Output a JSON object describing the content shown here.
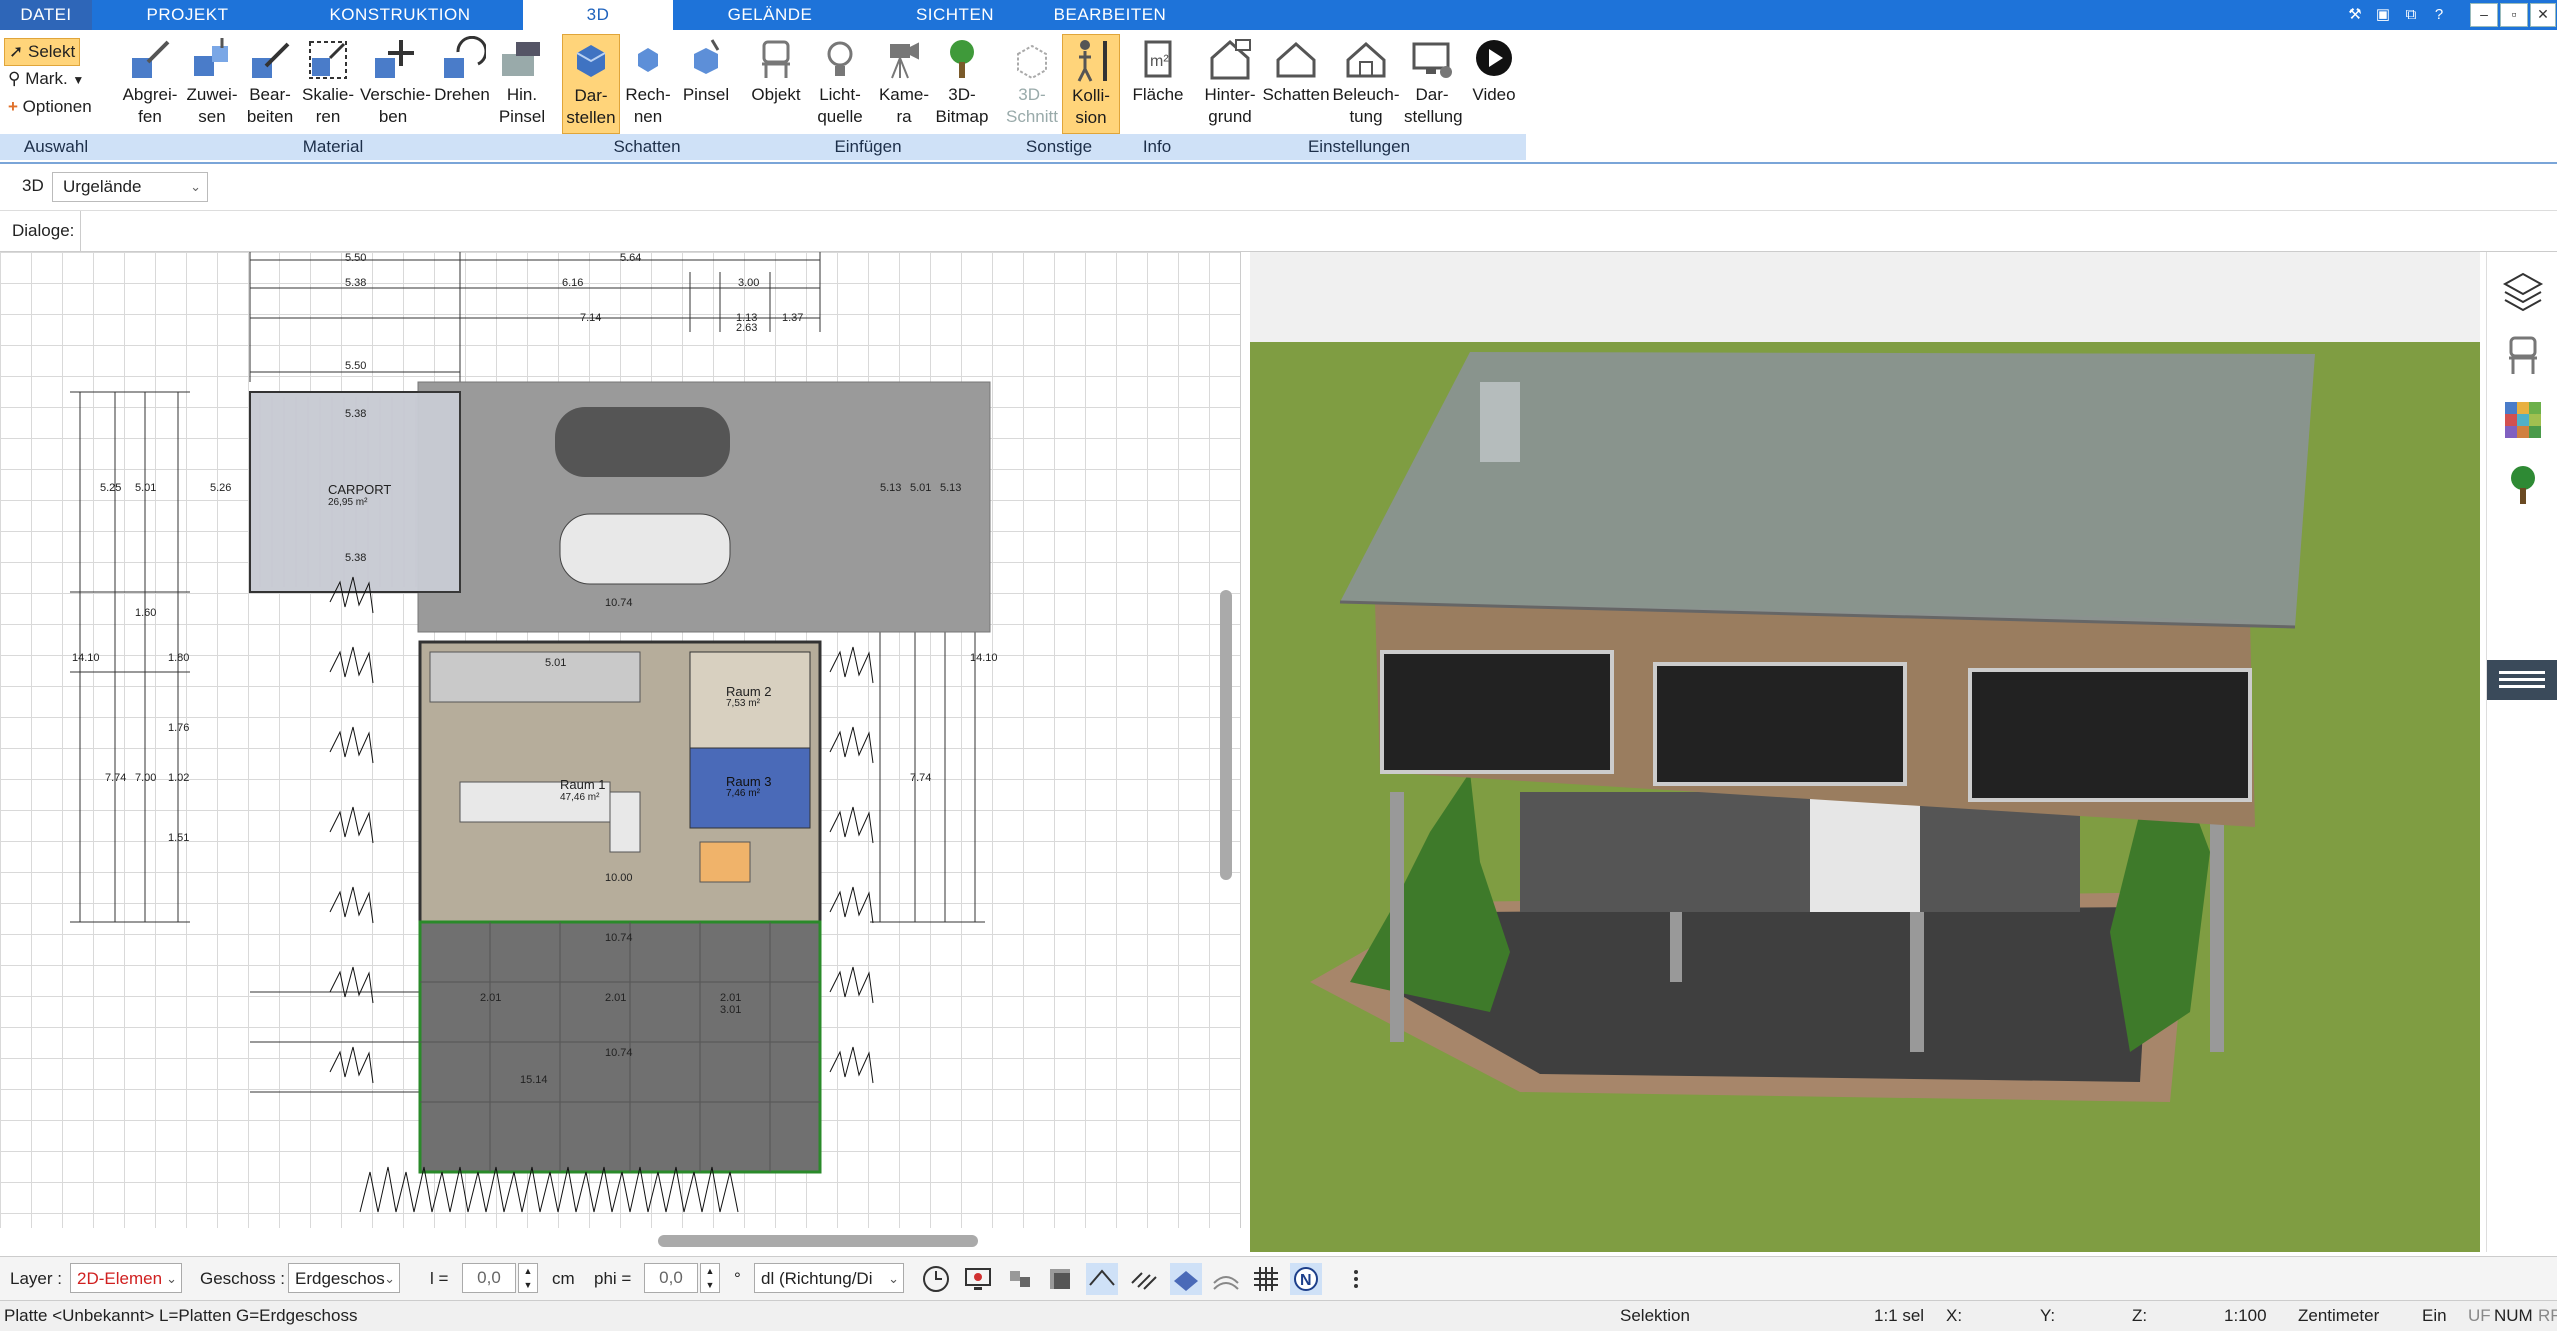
{
  "tabs": [
    "DATEI",
    "PROJEKT",
    "KONSTRUKTION",
    "3D",
    "GELÄNDE",
    "SICHTEN",
    "BEARBEITEN"
  ],
  "active_tab": "3D",
  "ribbon": {
    "auswahl": {
      "label": "Auswahl",
      "selekt": "Selekt",
      "mark": "Mark.",
      "optionen": "Optionen"
    },
    "material": {
      "label": "Material",
      "buttons": [
        "Abgrei-\nfen",
        "Zuwei-\nsen",
        "Bear-\nbeiten",
        "Skalie-\nren",
        "Verschie-\nben",
        "Drehen",
        "Hin.\nPinsel"
      ]
    },
    "schatten": {
      "label": "Schatten",
      "buttons": [
        "Dar-\nstellen",
        "Rech-\nnen",
        "Pinsel"
      ]
    },
    "einfuegen": {
      "label": "Einfügen",
      "buttons": [
        "Objekt",
        "Licht-\nquelle",
        "Kame-\nra",
        "3D-\nBitmap"
      ]
    },
    "sonstige": {
      "label": "Sonstige",
      "buttons": [
        "3D-\nSchnitt",
        "Kolli-\nsion"
      ]
    },
    "info": {
      "label": "Info",
      "buttons": [
        "Fläche"
      ]
    },
    "einstellungen": {
      "label": "Einstellungen",
      "buttons": [
        "Hinter-\ngrund",
        "Schatten",
        "Beleuch-\ntung",
        "Dar-\nstellung",
        "Video"
      ]
    }
  },
  "bar3d": {
    "label": "3D",
    "dropdown": "Urgelände"
  },
  "dialoge": "Dialoge:",
  "plan": {
    "dims": [
      "5.50",
      "5.64",
      "5.38",
      "6.16",
      "3.00",
      "1.13",
      "2.63",
      "7.14",
      "1.37",
      "5.50",
      "5.38",
      "5.38",
      "10.74",
      "10.74",
      "10.00",
      "10.74",
      "15.14",
      "5.25",
      "5.01",
      "5.26",
      "5.13",
      "5.01",
      "5.13",
      "14.10",
      "14.10",
      "7.74",
      "7.00",
      "7.74",
      "1.76",
      "1.51",
      "1.02",
      "1.60",
      "1.80",
      "2.01",
      "2.01",
      "2.01",
      "3.01",
      "5.01"
    ],
    "carport": "CARPORT",
    "carport_area": "26,95 m²",
    "raum1": "Raum 1",
    "raum1_area": "47,46 m²",
    "raum2": "Raum 2",
    "raum2_area": "7,53 m²",
    "raum3": "Raum 3",
    "raum3_area": "7,46 m²"
  },
  "bottombar": {
    "layer_label": "Layer :",
    "layer_value": "2D-Elemen",
    "geschoss_label": "Geschoss :",
    "geschoss_value": "Erdgeschos",
    "l_label": "l =",
    "l_value": "0,0",
    "l_unit": "cm",
    "phi_label": "phi =",
    "phi_value": "0,0",
    "phi_unit": "°",
    "dl_value": "dl (Richtung/Di"
  },
  "statusbar": {
    "left": "Platte <Unbekannt> L=Platten G=Erdgeschoss",
    "mode": "Selektion",
    "scale_sel": "1:1 sel",
    "x": "X:",
    "y": "Y:",
    "z": "Z:",
    "scale": "1:100",
    "unit": "Zentimeter",
    "ein": "Ein",
    "uf": "UF",
    "num": "NUM",
    "rf": "RF"
  },
  "colors": {
    "tabbar": "#1e73d9",
    "ribbon_group": "#cfe1f7",
    "active_button": "#ffd47a",
    "grass": "#7f9d42",
    "roof": "#8a9494"
  }
}
